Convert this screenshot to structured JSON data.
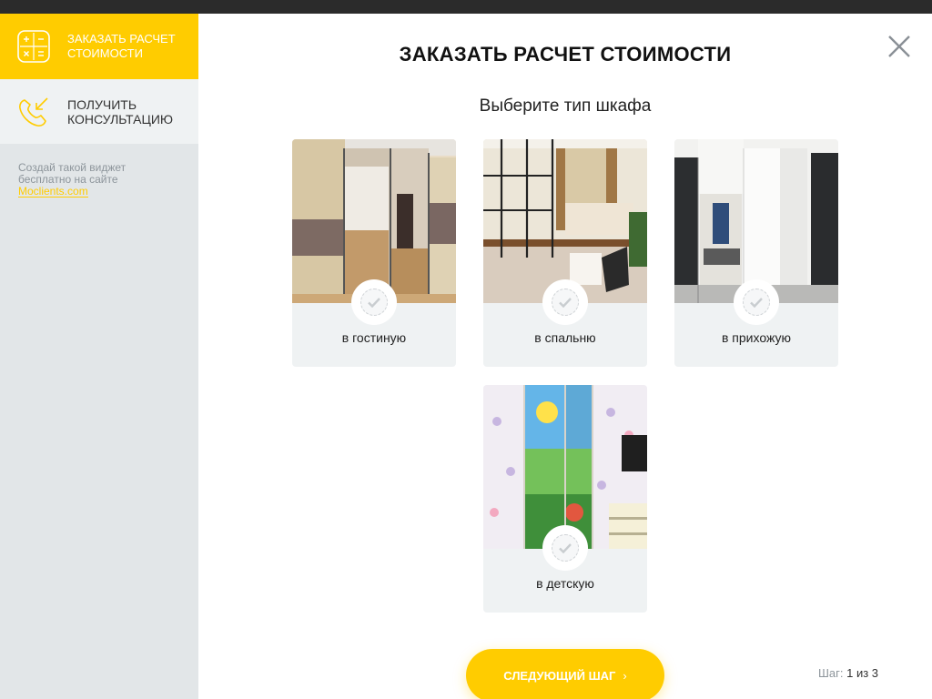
{
  "sidebar": {
    "items": [
      {
        "label_line1": "ЗАКАЗАТЬ РАСЧЕТ",
        "label_line2": "СТОИМОСТИ",
        "icon": "calculator-icon",
        "active": true
      },
      {
        "label_line1": "ПОЛУЧИТЬ",
        "label_line2": "КОНСУЛЬТАЦИЮ",
        "icon": "phone-callback-icon",
        "active": false
      }
    ],
    "promo_line1": "Создай такой виджет",
    "promo_line2": "бесплатно на сайте",
    "promo_link": "Moclients.com"
  },
  "modal": {
    "title": "ЗАКАЗАТЬ РАСЧЕТ СТОИМОСТИ",
    "subtitle": "Выберите тип шкафа",
    "options": [
      {
        "label": "в гостиную",
        "image": "living-room-wardrobe"
      },
      {
        "label": "в спальню",
        "image": "bedroom-wardrobe"
      },
      {
        "label": "в прихожую",
        "image": "hallway-wardrobe"
      },
      {
        "label": "в детскую",
        "image": "kids-room-wardrobe"
      }
    ],
    "next_button": "Следующий шаг",
    "next_chevron": "›",
    "step_label": "Шаг:",
    "step_value": "1 из 3"
  },
  "colors": {
    "accent": "#ffcc00",
    "sidebar_bg": "#e2e6e8",
    "card_bg": "#eff2f3"
  }
}
